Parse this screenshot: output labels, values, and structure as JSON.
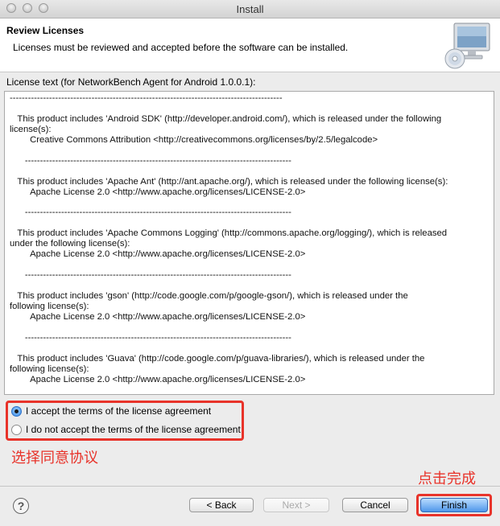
{
  "window": {
    "title": "Install"
  },
  "header": {
    "title": "Review Licenses",
    "description": "Licenses must be reviewed and accepted before the software can be installed.",
    "icon": "monitor-cd-icon"
  },
  "license": {
    "label": "License text (for NetworkBench Agent for Android 1.0.0.1):",
    "text": "------------------------------------------------------------------------------------------\n\n   This product includes 'Android SDK' (http://developer.android.com/), which is released under the following\nlicense(s):\n        Creative Commons Attribution <http://creativecommons.org/licenses/by/2.5/legalcode>\n\n      ----------------------------------------------------------------------------------------\n\n   This product includes 'Apache Ant' (http://ant.apache.org/), which is released under the following license(s):\n        Apache License 2.0 <http://www.apache.org/licenses/LICENSE-2.0>\n\n      ----------------------------------------------------------------------------------------\n\n   This product includes 'Apache Commons Logging' (http://commons.apache.org/logging/), which is released\nunder the following license(s):\n        Apache License 2.0 <http://www.apache.org/licenses/LICENSE-2.0>\n\n      ----------------------------------------------------------------------------------------\n\n   This product includes 'gson' (http://code.google.com/p/google-gson/), which is released under the\nfollowing license(s):\n        Apache License 2.0 <http://www.apache.org/licenses/LICENSE-2.0>\n\n      ----------------------------------------------------------------------------------------\n\n   This product includes 'Guava' (http://code.google.com/p/guava-libraries/), which is released under the\nfollowing license(s):\n        Apache License 2.0 <http://www.apache.org/licenses/LICENSE-2.0>"
  },
  "options": {
    "accept": {
      "label": "I accept the terms of the license agreement",
      "selected": true
    },
    "decline": {
      "label": "I do not accept the terms of the license agreement",
      "selected": false
    }
  },
  "annotations": {
    "select_agree": "选择同意协议",
    "click_finish": "点击完成",
    "color": "#e8332a"
  },
  "buttons": {
    "help_icon": "help-icon",
    "back": "< Back",
    "next": "Next >",
    "cancel": "Cancel",
    "finish": "Finish"
  }
}
